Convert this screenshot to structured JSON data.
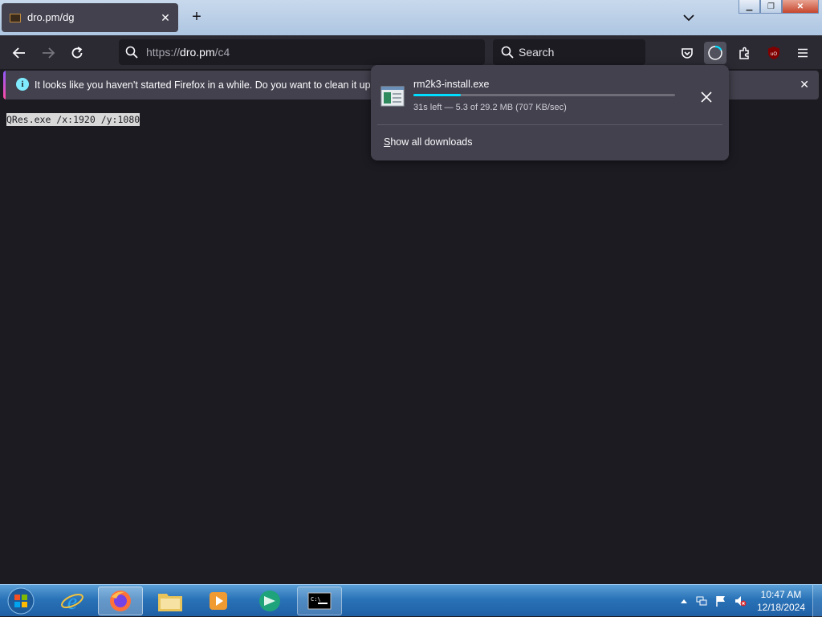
{
  "tab": {
    "title": "dro.pm/dg",
    "close_glyph": "✕",
    "new_tab_glyph": "+"
  },
  "window_controls": {
    "minimize": "▁",
    "restore": "❐",
    "close": "✕"
  },
  "urlbar": {
    "prefix": "https://",
    "domain": "dro.pm",
    "path": "/c4"
  },
  "searchbar": {
    "placeholder": "Search"
  },
  "notification": {
    "text": "It looks like you haven't started Firefox in a while. Do you want to clean it up for",
    "close_glyph": "✕"
  },
  "page": {
    "content": "QRes.exe /x:1920 /y:1080"
  },
  "downloads_panel": {
    "filename": "rm2k3-install.exe",
    "status": "31s left — 5.3 of 29.2 MB (707 KB/sec)",
    "progress_fraction": 0.18,
    "show_all_label": "Show all downloads",
    "show_all_accesskey": "S",
    "show_all_rest": "how all downloads"
  },
  "taskbar": {
    "items": [
      "start-orb",
      "internet-explorer",
      "firefox",
      "file-explorer",
      "media-player",
      "app",
      "command-prompt"
    ]
  },
  "clock": {
    "time": "10:47 AM",
    "date": "12/18/2024"
  },
  "colors": {
    "accent": "#00ddff",
    "toolbar": "#2b2a33",
    "content": "#1c1b22"
  }
}
